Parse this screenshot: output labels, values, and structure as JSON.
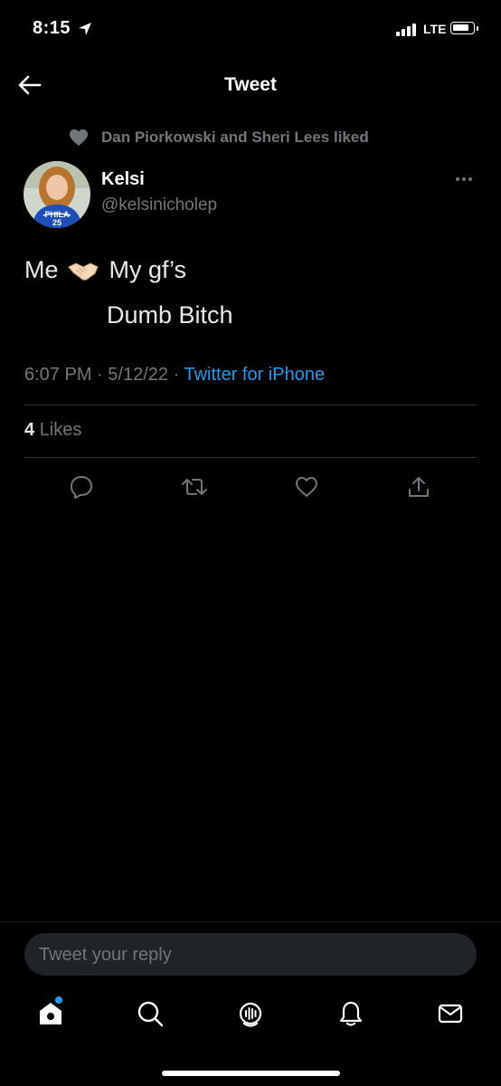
{
  "status_bar": {
    "time": "8:15",
    "network": "LTE",
    "icons": [
      "location-arrow-icon",
      "signal-bars-icon",
      "battery-icon"
    ]
  },
  "header": {
    "title": "Tweet",
    "back_icon": "arrow-left-icon"
  },
  "social_context": {
    "text": "Dan Piorkowski and Sheri Lees liked",
    "icon": "heart-filled-icon"
  },
  "author": {
    "name": "Kelsi",
    "handle": "@kelsinicholep",
    "avatar_jersey_text": "PHILA",
    "avatar_jersey_number": "25"
  },
  "tweet": {
    "line1_before": "Me",
    "line1_after": "My gf’s",
    "line2": "Dumb Bitch",
    "emoji": "handshake-emoji"
  },
  "meta": {
    "time": "6:07 PM",
    "separator": "·",
    "date": "5/12/22",
    "source": "Twitter for iPhone"
  },
  "stats": {
    "likes_count": "4",
    "likes_label": "Likes"
  },
  "actions": [
    "reply-icon",
    "retweet-icon",
    "like-icon",
    "share-icon"
  ],
  "reply": {
    "placeholder": "Tweet your reply"
  },
  "tab_bar": [
    "home-icon",
    "search-icon",
    "spaces-icon",
    "notifications-icon",
    "messages-icon"
  ],
  "colors": {
    "background": "#000000",
    "text": "#e7e9ea",
    "secondary": "#71767b",
    "accent": "#1d9bf0",
    "divider": "#2f3336"
  }
}
